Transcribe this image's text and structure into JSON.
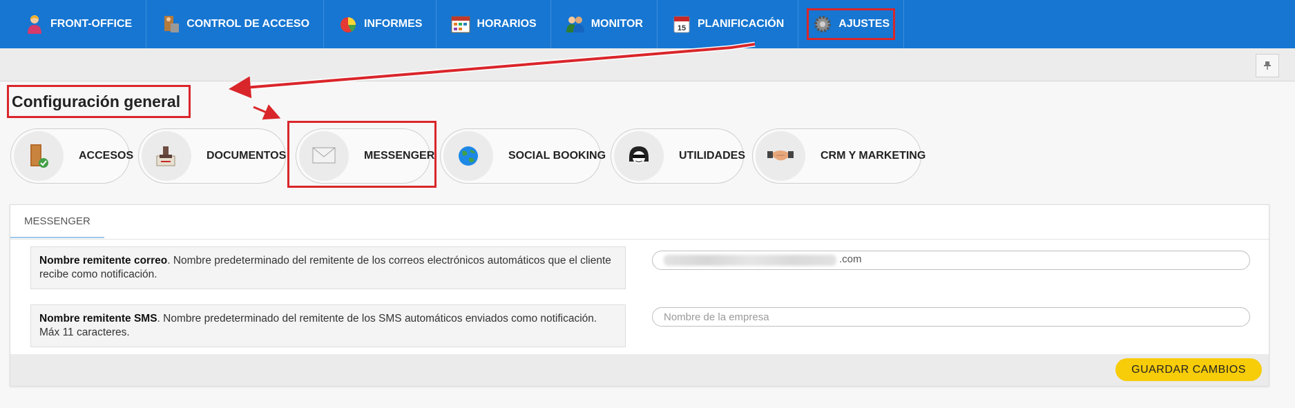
{
  "nav": {
    "items": [
      {
        "label": "FRONT-OFFICE",
        "icon": "receptionist-icon"
      },
      {
        "label": "CONTROL DE ACCESO",
        "icon": "access-control-icon"
      },
      {
        "label": "INFORMES",
        "icon": "pie-chart-icon"
      },
      {
        "label": "HORARIOS",
        "icon": "calendar-grid-icon"
      },
      {
        "label": "MONITOR",
        "icon": "people-icon"
      },
      {
        "label": "PLANIFICACIÓN",
        "icon": "calendar-15-icon"
      },
      {
        "label": "AJUSTES",
        "icon": "gear-icon"
      }
    ],
    "active": "AJUSTES"
  },
  "page": {
    "title": "Configuración general"
  },
  "categories": [
    {
      "label": "ACCESOS",
      "icon": "door-icon"
    },
    {
      "label": "DOCUMENTOS",
      "icon": "document-stamp-icon"
    },
    {
      "label": "MESSENGER",
      "icon": "envelope-icon"
    },
    {
      "label": "SOCIAL BOOKING",
      "icon": "globe-icon"
    },
    {
      "label": "UTILIDADES",
      "icon": "helmet-icon"
    },
    {
      "label": "CRM Y MARKETING",
      "icon": "handshake-icon"
    }
  ],
  "panel": {
    "tab": "MESSENGER",
    "rows": [
      {
        "label_bold": "Nombre remitente correo",
        "label_text": ". Nombre predeterminado del remitente de los correos electrónicos automáticos que el cliente recibe como notificación.",
        "value_suffix": ".com"
      },
      {
        "label_bold": "Nombre remitente SMS",
        "label_text": ". Nombre predeterminado del remitente de los SMS automáticos enviados como notificación. Máx 11 caracteres.",
        "placeholder": "Nombre de la empresa"
      }
    ],
    "save_label": "GUARDAR CAMBIOS"
  },
  "colors": {
    "nav_bg": "#1676d2",
    "highlight": "#d9262b",
    "save_button": "#f7cc08"
  }
}
